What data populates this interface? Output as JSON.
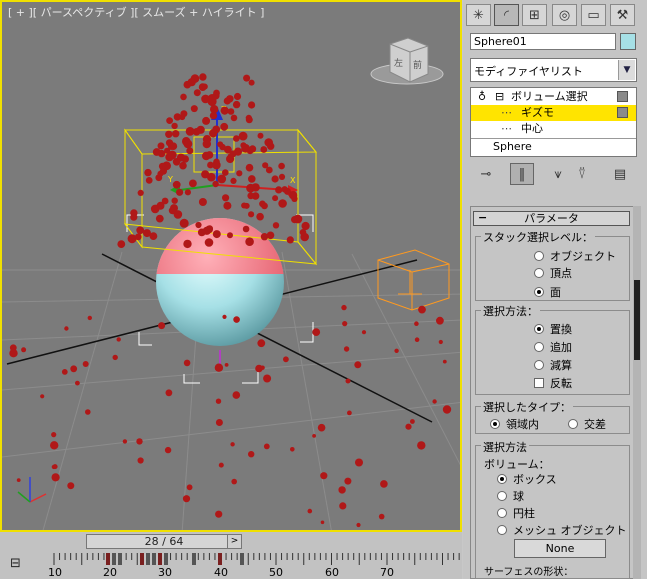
{
  "viewport": {
    "label": "[ + ][ パースペクティブ ][ スムーズ + ハイライト ]",
    "viewcube": {
      "left_face": "左",
      "front_face": "前"
    },
    "gizmo_axes": {
      "x": "X",
      "y": "Y",
      "z": "Z"
    }
  },
  "command_panel": {
    "tabs": [
      "create-icon",
      "modify-icon",
      "hierarchy-icon",
      "motion-icon",
      "display-icon",
      "utilities-icon"
    ],
    "object_name": "Sphere01",
    "object_color": "#a6e0e6",
    "modifier_list": "モディファイヤリスト",
    "stack": {
      "modifier": "ボリューム選択",
      "gizmo": "ギズモ",
      "center": "中心",
      "base": "Sphere"
    },
    "rollout_title": "パラメータ",
    "stack_level": {
      "title": "スタック選択レベル：",
      "options": [
        "オブジェクト",
        "頂点",
        "面"
      ],
      "selected": "面"
    },
    "select_by": {
      "title": "選択方法：",
      "options": [
        "置換",
        "追加",
        "減算"
      ],
      "selected": "置換",
      "invert": "反転"
    },
    "select_type": {
      "title": "選択したタイプ：",
      "options": [
        "領域内",
        "交差"
      ],
      "selected": "領域内"
    },
    "volume": {
      "title": "選択方法",
      "subtitle": "ボリューム：",
      "options": [
        "ボックス",
        "球",
        "円柱",
        "メッシュ オブジェクト"
      ],
      "selected": "ボックス",
      "none_button": "None",
      "next_title": "サーフェスの形状："
    }
  },
  "timeline": {
    "frame_display": "28 / 64",
    "ticks": [
      "10",
      "20",
      "30",
      "40",
      "50",
      "60",
      "70"
    ]
  },
  "colors": {
    "viewport_border": "#f0e000",
    "selection_highlight": "#ffe400",
    "particle": "#b01818"
  }
}
